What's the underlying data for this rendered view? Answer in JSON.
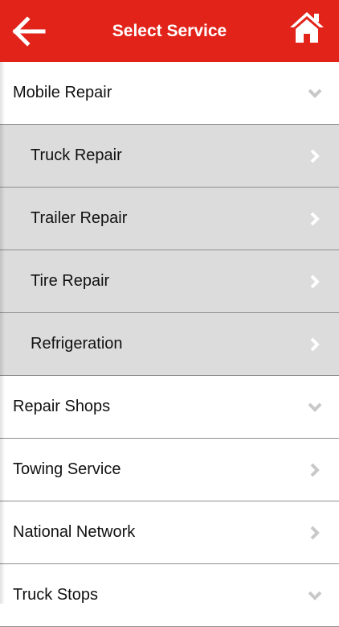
{
  "header": {
    "title": "Select Service",
    "back_icon": "arrow-left-icon",
    "home_icon": "home-icon",
    "accent_color": "#e2231a"
  },
  "services": {
    "mobile_repair": {
      "label": "Mobile Repair",
      "expanded": true,
      "children": [
        {
          "label": "Truck Repair"
        },
        {
          "label": "Trailer Repair"
        },
        {
          "label": "Tire Repair"
        },
        {
          "label": "Refrigeration"
        }
      ]
    },
    "repair_shops": {
      "label": "Repair Shops"
    },
    "towing_service": {
      "label": "Towing Service"
    },
    "national_network": {
      "label": "National Network"
    },
    "truck_stops": {
      "label": "Truck Stops"
    }
  }
}
